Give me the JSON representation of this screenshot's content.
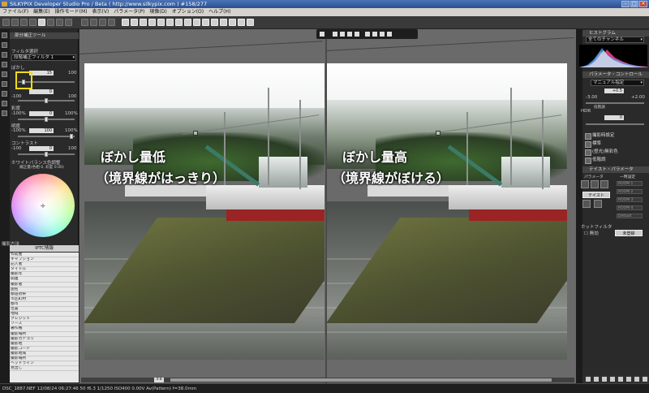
{
  "window": {
    "title": "SILKYPIX Developer Studio Pro / Beta ( http://www.silkypix.com )   #158/277"
  },
  "menu": [
    "ファイル(F)",
    "編集(E)",
    "操作モード(M)",
    "表示(V)",
    "パラメータ(P)",
    "現像(D)",
    "オプション(O)",
    "ヘルプ(H)"
  ],
  "left_panel": {
    "header": "部分補正ツール",
    "filter_label": "フィルタ選択",
    "filter_value": "段階補正フィルタ 1",
    "blur_label": "ぼかし",
    "blur_value": "15",
    "blur_max": "100",
    "exposure_min": "-100",
    "exposure_value": "0",
    "exposure_max": "100",
    "saturation_label": "彩度",
    "saturation_min": "-100%",
    "saturation_value": "0",
    "saturation_max": "100%",
    "brightness_label": "明度",
    "brightness_min": "-100%",
    "brightness_value": "100",
    "brightness_max": "100%",
    "contrast_label": "コントラスト",
    "contrast_min": "-100",
    "contrast_value": "0",
    "contrast_max": "100",
    "wb_label": "ホワイトバランス色調整",
    "wb_value": "補正量(色相 0, 彩度 0.00)",
    "wheel_foot": "撮影方法",
    "iptc_header": "IPTC情報",
    "iptc_rows": [
      "作成者",
      "キャプション",
      "記入者",
      "タイトル",
      "撮影年",
      "関連",
      "撮影者",
      "国名",
      "都道府県",
      "市区町村",
      "都市",
      "位置",
      "地域",
      "クレジット",
      "ソース",
      "著作権",
      "撮影場所",
      "撮影カテゴリ",
      "撮影地",
      "撮影コード",
      "撮影地域",
      "撮影場所",
      "ヘッドライン",
      "見出し"
    ]
  },
  "view": {
    "caption_left_line1": "ぼかし量低",
    "caption_left_line2": "（境界線がはっきり）",
    "caption_right_line1": "ぼかし量高",
    "caption_right_line2": "（境界線がぼける）",
    "zoom": "4:8"
  },
  "right_panel": {
    "histogram_header": "ヒストグラム",
    "histogram_channel": "全てのチャンネル",
    "param_header": "パラメータ・コントロール",
    "mode_value": "マニュアル指定",
    "exposure_value": "+0.5",
    "exposure_min": "-3.00",
    "exposure_max": "+2.00",
    "item_hint": "低階調",
    "hdr_label": "HDR",
    "hdr_value": "0",
    "rows": [
      "撮影時設定",
      "標準",
      "(昼光)無彩色",
      "低階調"
    ],
    "taste_header": "テイスト・パラメータ",
    "taste_col1": "パラメータ",
    "taste_col2": "一時設定",
    "taste_button": "テイスト",
    "rooms": [
      "ROOM 1",
      "ROOM 2",
      "ROOM 3",
      "ROOM 4",
      "Default"
    ],
    "hot_filter": "ホットフィルタ",
    "disabled": "無効",
    "unset": "未登録"
  },
  "status": "DSC_1887.NEF  12/08/24 06:27:46  50 f6.3 1/1250 ISO400  0.00V Av(Pattern) f=38.0mm"
}
